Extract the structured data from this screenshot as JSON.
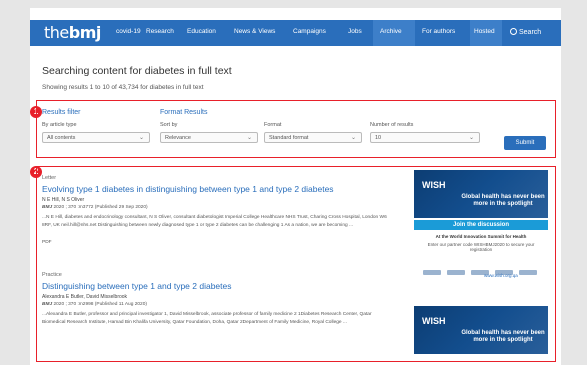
{
  "nav": {
    "logo_thin": "the",
    "logo_bold": "bmj",
    "items": [
      "covid-19",
      "Research",
      "Education",
      "News & Views",
      "Campaigns",
      "Jobs",
      "Archive",
      "For authors",
      "Hosted"
    ],
    "search": "Search"
  },
  "heading": "Searching content for diabetes in full text",
  "subline": "Showing results 1 to 10 of 43,734 for diabetes in full text",
  "filter": {
    "badge": "1",
    "title_filter": "Results filter",
    "title_format": "Format Results",
    "label_type": "By article type",
    "value_type": "All contents",
    "label_sort": "Sort by",
    "value_sort": "Relevance",
    "label_format": "Format",
    "value_format": "Standard format",
    "label_num": "Number of results",
    "value_num": "10",
    "submit": "Submit"
  },
  "results": {
    "badge": "2",
    "items": [
      {
        "type": "Letter",
        "title": "Evolving type 1 diabetes in distinguishing between type 1 and type 2 diabetes",
        "authors": "N E Hill, N S Oliver",
        "journal": "BMJ",
        "meta": " 2020 ; 370 :m3772 (Published 29 Sep 2020)",
        "snippet": "...N E Hill, diabetes and endocrinology consultant, N S Oliver, consultant diabetologist Imperial College Healthcare NHS Trust, Charing Cross Hospital, London W6 8RF, UK neil.hill@nhs.net Distinguishing between newly diagnosed type 1 or type 2 diabetes can be challenging 1 As a nation, we are becoming ...",
        "pdf": "PDF"
      },
      {
        "type": "Practice",
        "title": "Distinguishing between type 1 and type 2 diabetes",
        "authors": "Alexandra E Butler, David Misselbrook",
        "journal": "BMJ",
        "meta": " 2020 ; 370 :m2998 (Published 11 Aug 2020)",
        "snippet": "...Alexandra E Butler, professor and principal investigator 1, David Misselbrook, associate professor of family medicine 2 1Diabetes Research Center, Qatar Biomedical Research Institute, Hamad Bin Khalifa University, Qatar Foundation, Doha, Qatar 2Department of Family Medicine, Royal College ..."
      }
    ]
  },
  "ad": {
    "wish": "WISH",
    "headline": "Global health has never been more in the spotlight",
    "join": "Join the discussion",
    "summit": "At the World Innovation Summit for Health",
    "small": "Enter our partner code WISHBMJ2020 to secure your registration",
    "url": "www.wish.org.qa"
  }
}
